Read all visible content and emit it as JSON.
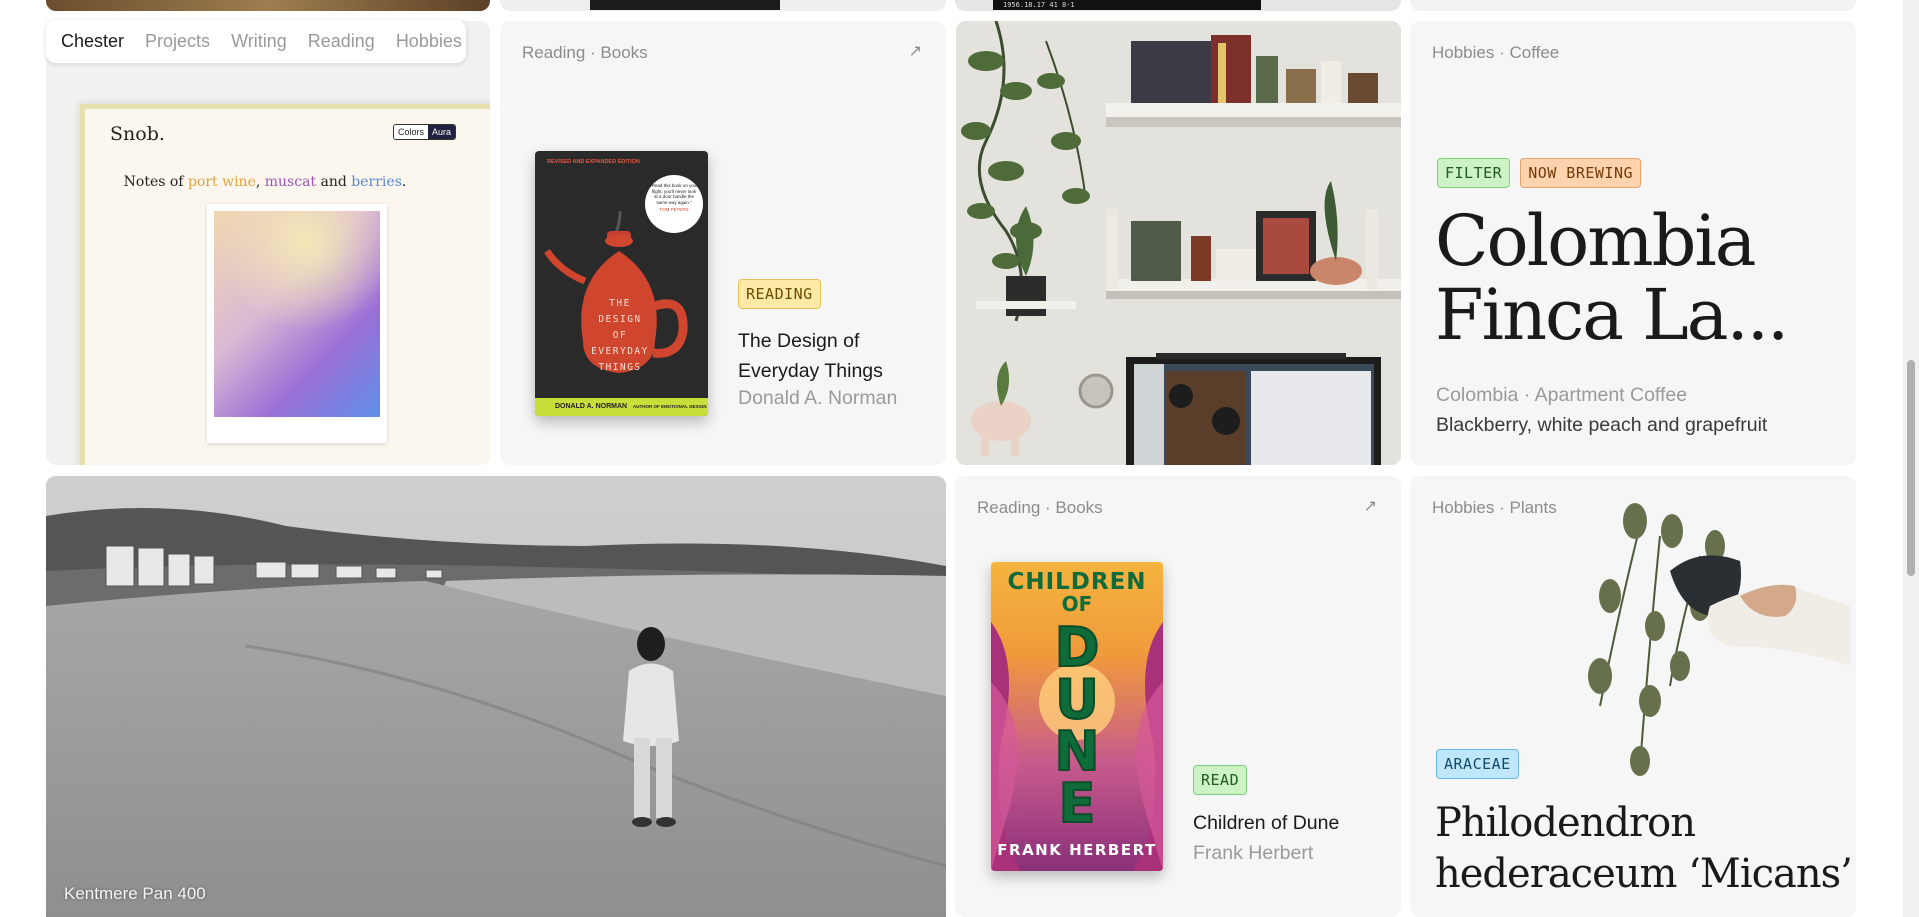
{
  "nav": {
    "items": [
      "Chester",
      "Projects",
      "Writing",
      "Reading",
      "Hobbies"
    ],
    "active": "Chester"
  },
  "snob": {
    "logo": "Snob.",
    "toggle": [
      "Colors",
      "Aura"
    ],
    "tagline_prefix": "Notes of ",
    "word1": "port wine",
    "sep1": ", ",
    "word2": "muscat",
    "sep2": " and ",
    "word3": "berries",
    "suffix": "."
  },
  "book1": {
    "meta": "Reading · Books",
    "tag": "READING",
    "title_line1": "The Design of",
    "title_line2": "Everyday Things",
    "author": "Donald A. Norman",
    "cover": {
      "top_text": "REVISED AND EXPANDED EDITION",
      "quote": "\"Read this book on your flight, you'll never look at a door handle the same way again.\"",
      "quote_by": "TOM PETERS",
      "title": [
        "THE",
        "DESIGN",
        "OF",
        "EVERYDAY",
        "THINGS"
      ],
      "author_band": "DONALD A. NORMAN",
      "author_band_suffix": "AUTHOR OF EMOTIONAL DESIGN"
    }
  },
  "coffee": {
    "meta": "Hobbies · Coffee",
    "tags": [
      "FILTER",
      "NOW BREWING"
    ],
    "title_line1": "Colombia",
    "title_line2": "Finca La...",
    "origin": "Colombia · Apartment Coffee",
    "notes": "Blackberry, white peach and grapefruit"
  },
  "film": {
    "caption": "Kentmere Pan 400"
  },
  "book2": {
    "meta": "Reading · Books",
    "tag": "READ",
    "title": "Children of Dune",
    "author": "Frank Herbert",
    "cover": {
      "line1": "CHILDREN",
      "line2": "OF",
      "line3": "DUNE",
      "author": "FRANK HERBERT"
    }
  },
  "plant": {
    "meta": "Hobbies · Plants",
    "tag": "ARACEAE",
    "name_line1": "Philodendron",
    "name_line2": "hederaceum ‘Micans’"
  }
}
